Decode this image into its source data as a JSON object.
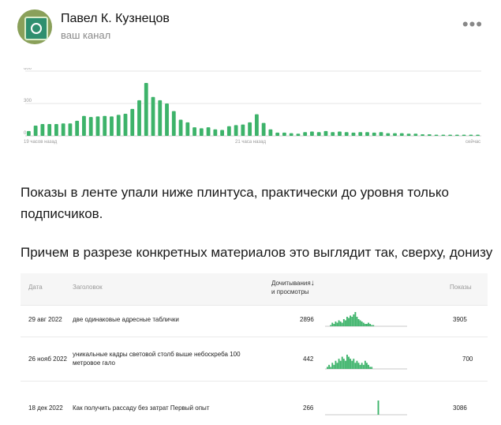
{
  "header": {
    "author": "Павел К. Кузнецов",
    "channel": "ваш канал",
    "more_icon": "more-horizontal-icon"
  },
  "chart_data": {
    "type": "bar",
    "ylim": [
      0,
      600
    ],
    "yticks": [
      "600",
      "300",
      "0"
    ],
    "xlabels": [
      "19 часов назад",
      "21 часа назад",
      "сейчас"
    ],
    "values": [
      45,
      95,
      110,
      110,
      110,
      115,
      115,
      140,
      185,
      175,
      180,
      185,
      180,
      195,
      205,
      250,
      330,
      490,
      360,
      330,
      300,
      230,
      150,
      125,
      80,
      70,
      80,
      60,
      55,
      90,
      100,
      105,
      125,
      200,
      120,
      60,
      30,
      30,
      25,
      20,
      35,
      40,
      35,
      45,
      35,
      40,
      35,
      30,
      35,
      35,
      30,
      35,
      25,
      25,
      25,
      20,
      20,
      15,
      15,
      10,
      10,
      5,
      5,
      5,
      3,
      3
    ],
    "color": "#3db36a",
    "grid": true
  },
  "text": {
    "p1": "Показы в ленте упали ниже плинтуса, практически до уровня только подписчиков.",
    "p2": "Причем в разрезе конкретных материалов это выглядит так, сверху, донизу"
  },
  "table": {
    "headers": {
      "date": "Дата",
      "title": "Заголовок",
      "reads_line1": "Дочитывания",
      "reads_line2": "и просмотры",
      "sort_icon": "arrow-down-icon",
      "shows": "Показы"
    },
    "rows": [
      {
        "date": "29 авг 2022",
        "title1": "две одинаковые адресные таблички",
        "title2": "",
        "reads": "2896",
        "shows": "3905",
        "spark": [
          0,
          0,
          0,
          1,
          3,
          2,
          4,
          3,
          5,
          4,
          3,
          6,
          5,
          8,
          7,
          9,
          8,
          10,
          12,
          8,
          6,
          5,
          4,
          3,
          2,
          2,
          3,
          2,
          1,
          1,
          0,
          0,
          0,
          0,
          0,
          0,
          0,
          0,
          0,
          0,
          0,
          0,
          0,
          0,
          0,
          0,
          0,
          0,
          0,
          0
        ]
      },
      {
        "date": "26 нояб 2022",
        "title1": "уникальные кадры световой столб выше небоскреба 100",
        "title2": "метровое гало",
        "reads": "442",
        "shows": "700",
        "spark": [
          0,
          1,
          2,
          1,
          3,
          2,
          4,
          3,
          5,
          4,
          6,
          5,
          4,
          7,
          6,
          5,
          4,
          5,
          3,
          4,
          3,
          2,
          3,
          2,
          4,
          3,
          2,
          1,
          1,
          0,
          0,
          0,
          0,
          0,
          0,
          0,
          0,
          0,
          0,
          0,
          0,
          0,
          0,
          0,
          0,
          0,
          0,
          0,
          0,
          0
        ]
      },
      {
        "date": "18 дек 2022",
        "title1": "Как получить рассаду без затрат Первый опыт",
        "title2": "",
        "reads": "266",
        "shows": "3086",
        "spark": [
          0,
          0,
          0,
          0,
          0,
          0,
          0,
          0,
          0,
          0,
          0,
          0,
          0,
          0,
          0,
          0,
          0,
          0,
          0,
          0,
          0,
          0,
          0,
          0,
          0,
          0,
          0,
          0,
          0,
          0,
          0,
          0,
          14,
          0,
          0,
          0,
          0,
          0,
          0,
          0,
          0,
          0,
          0,
          0,
          0,
          0,
          0,
          0,
          0,
          0
        ]
      }
    ]
  }
}
